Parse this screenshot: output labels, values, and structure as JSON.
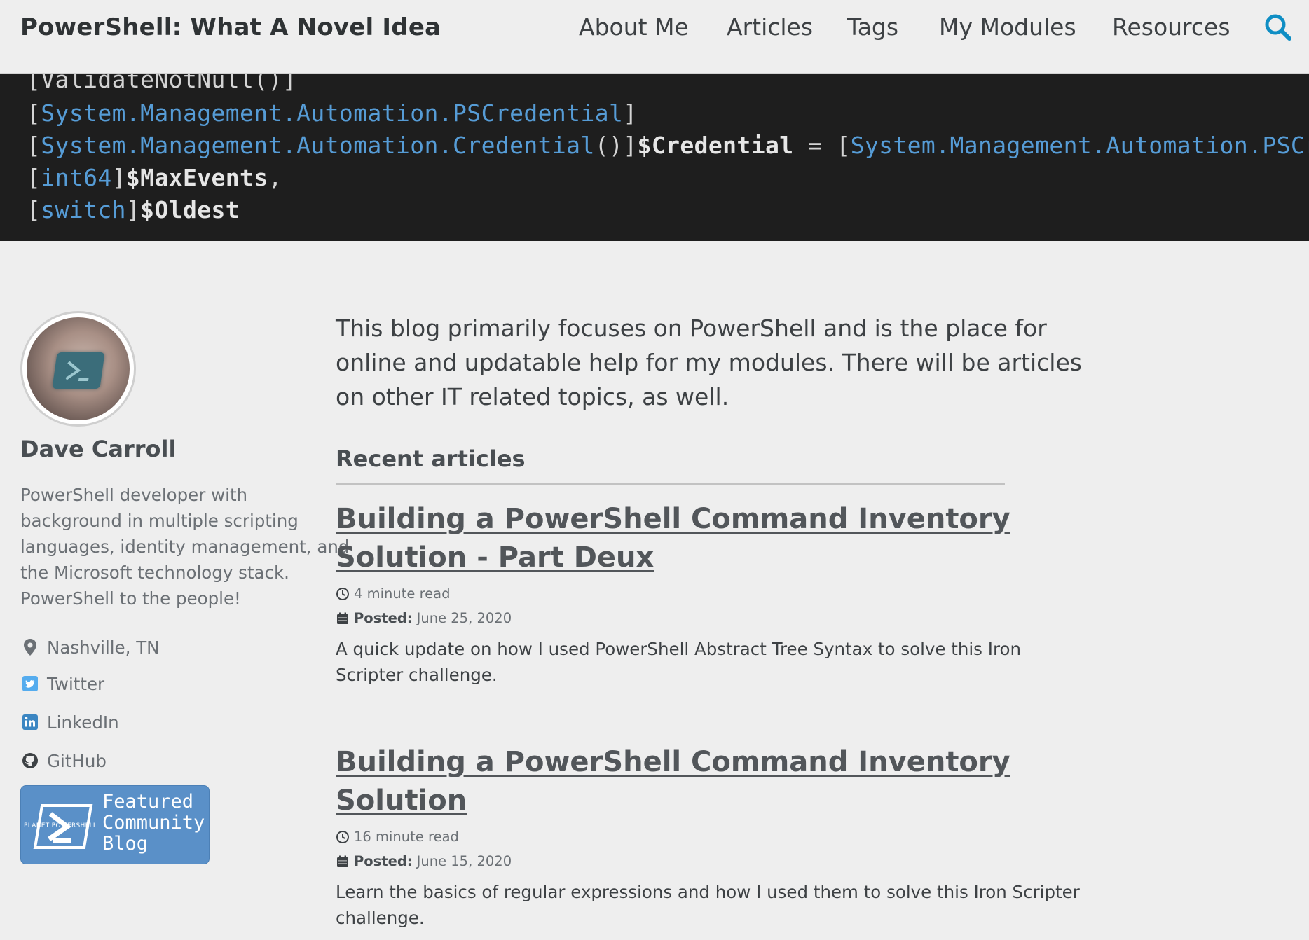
{
  "site": {
    "title": "PowerShell: What A Novel Idea"
  },
  "nav": {
    "items": [
      {
        "label": "About Me"
      },
      {
        "label": "Articles"
      },
      {
        "label": "Tags"
      },
      {
        "label": "My Modules"
      },
      {
        "label": "Resources"
      }
    ],
    "search_icon": "search-icon"
  },
  "header_code": {
    "lines": [
      [
        {
          "t": "br",
          "v": "[ValidateNotNull()]"
        }
      ],
      [
        {
          "t": "br",
          "v": "["
        },
        {
          "t": "type",
          "v": "System.Management.Automation.PSCredential"
        },
        {
          "t": "br",
          "v": "]"
        }
      ],
      [
        {
          "t": "br",
          "v": "["
        },
        {
          "t": "type",
          "v": "System.Management.Automation.Credential"
        },
        {
          "t": "br",
          "v": "()]"
        },
        {
          "t": "var",
          "v": "$Credential"
        },
        {
          "t": "op",
          "v": " = "
        },
        {
          "t": "br",
          "v": "["
        },
        {
          "t": "type",
          "v": "System.Management.Automation.PSCredentia"
        }
      ],
      [
        {
          "t": "br",
          "v": "["
        },
        {
          "t": "type",
          "v": "int64"
        },
        {
          "t": "br",
          "v": "]"
        },
        {
          "t": "var",
          "v": "$MaxEvents"
        },
        {
          "t": "op",
          "v": ","
        }
      ],
      [
        {
          "t": "br",
          "v": "["
        },
        {
          "t": "type",
          "v": "switch"
        },
        {
          "t": "br",
          "v": "]"
        },
        {
          "t": "var",
          "v": "$Oldest"
        }
      ]
    ]
  },
  "author": {
    "name": "Dave Carroll",
    "bio_lines": [
      "PowerShell developer with",
      "background in multiple scripting",
      "languages, identity management, and",
      "the Microsoft technology stack.",
      "PowerShell to the people!"
    ],
    "links": [
      {
        "label": "Nashville, TN",
        "icon": "map-marker-icon"
      },
      {
        "label": "Twitter",
        "icon": "twitter-icon"
      },
      {
        "label": "LinkedIn",
        "icon": "linkedin-icon"
      },
      {
        "label": "GitHub",
        "icon": "github-icon"
      }
    ],
    "badge": {
      "lines": [
        "Featured",
        "Community",
        "Blog"
      ],
      "sub": "PLANET POWERSHELL"
    }
  },
  "main": {
    "intro_lines": [
      "This blog primarily focuses on PowerShell and is the place for",
      "online and updatable help for my modules. There will be articles",
      "on other IT related topics, as well."
    ],
    "recent_title": "Recent articles",
    "posted_label": "Posted:",
    "articles": [
      {
        "title_lines": [
          "Building a PowerShell Command Inventory",
          "Solution - Part Deux"
        ],
        "read_time": "4 minute read",
        "date": "June 25, 2020",
        "excerpt_lines": [
          "A quick update on how I used PowerShell Abstract Tree Syntax to solve this Iron",
          "Scripter challenge."
        ]
      },
      {
        "title_lines": [
          "Building a PowerShell Command Inventory",
          "Solution"
        ],
        "read_time": "16 minute read",
        "date": "June 15, 2020",
        "excerpt_lines": [
          "Learn the basics of regular expressions and how I used them to solve this Iron Scripter",
          "challenge."
        ]
      }
    ]
  },
  "colors": {
    "accent": "#0f8ec4",
    "background": "#eeeeee",
    "code_bg": "#1e1e1e",
    "code_type": "#569cd6",
    "badge": "#5a90c8"
  }
}
